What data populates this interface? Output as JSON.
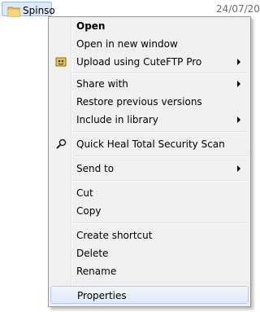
{
  "file": {
    "name": "Spinso",
    "date": "24/07/20"
  },
  "menu": {
    "items": [
      {
        "label": "Open"
      },
      {
        "label": "Open in new window"
      },
      {
        "label": "Upload using CuteFTP Pro"
      },
      {
        "label": "Share with"
      },
      {
        "label": "Restore previous versions"
      },
      {
        "label": "Include in library"
      },
      {
        "label": "Quick Heal Total Security Scan"
      },
      {
        "label": "Send to"
      },
      {
        "label": "Cut"
      },
      {
        "label": "Copy"
      },
      {
        "label": "Create shortcut"
      },
      {
        "label": "Delete"
      },
      {
        "label": "Rename"
      },
      {
        "label": "Properties"
      }
    ]
  },
  "colors": {
    "menu_bg": "#f0f0f0",
    "hover_border": "#aecef7",
    "selection": "#dbe8f8"
  },
  "icons": {
    "folder": "folder-icon",
    "cuteftp": "cuteftp-icon",
    "scan": "magnifier-icon",
    "submenu": "chevron-right-icon"
  }
}
